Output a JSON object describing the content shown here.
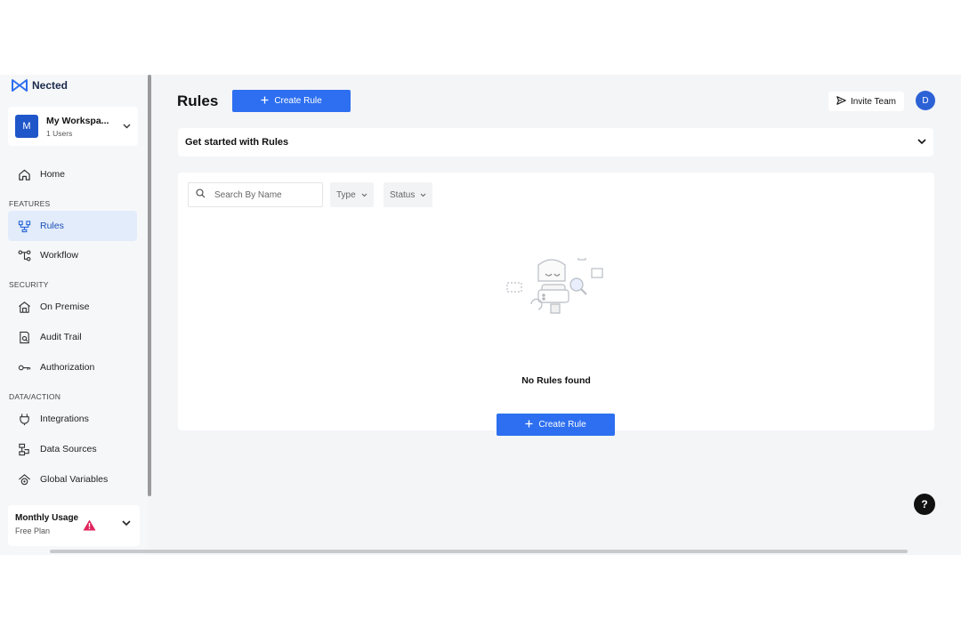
{
  "brand": {
    "name": "Nected"
  },
  "workspace": {
    "initial": "M",
    "name": "My Workspa...",
    "users": "1 Users"
  },
  "sidebar": {
    "home": "Home",
    "section_features": "FEATURES",
    "rules": "Rules",
    "workflow": "Workflow",
    "section_security": "SECURITY",
    "on_premise": "On Premise",
    "audit_trail": "Audit Trail",
    "authorization": "Authorization",
    "section_data": "DATA/ACTION",
    "integrations": "Integrations",
    "data_sources": "Data Sources",
    "global_variables": "Global Variables"
  },
  "usage": {
    "title": "Monthly Usage",
    "plan": "Free Plan"
  },
  "header": {
    "title": "Rules",
    "create_label": "Create Rule",
    "invite_label": "Invite Team",
    "user_initial": "D"
  },
  "get_started": {
    "title": "Get started with Rules"
  },
  "filters": {
    "search_placeholder": "Search By Name",
    "type_label": "Type",
    "status_label": "Status"
  },
  "empty": {
    "message": "No Rules found",
    "create_label": "Create Rule"
  },
  "help": {
    "label": "?"
  },
  "colors": {
    "primary": "#2d6ff0",
    "active_bg": "#e3ecfb",
    "warning": "#e0245e"
  }
}
